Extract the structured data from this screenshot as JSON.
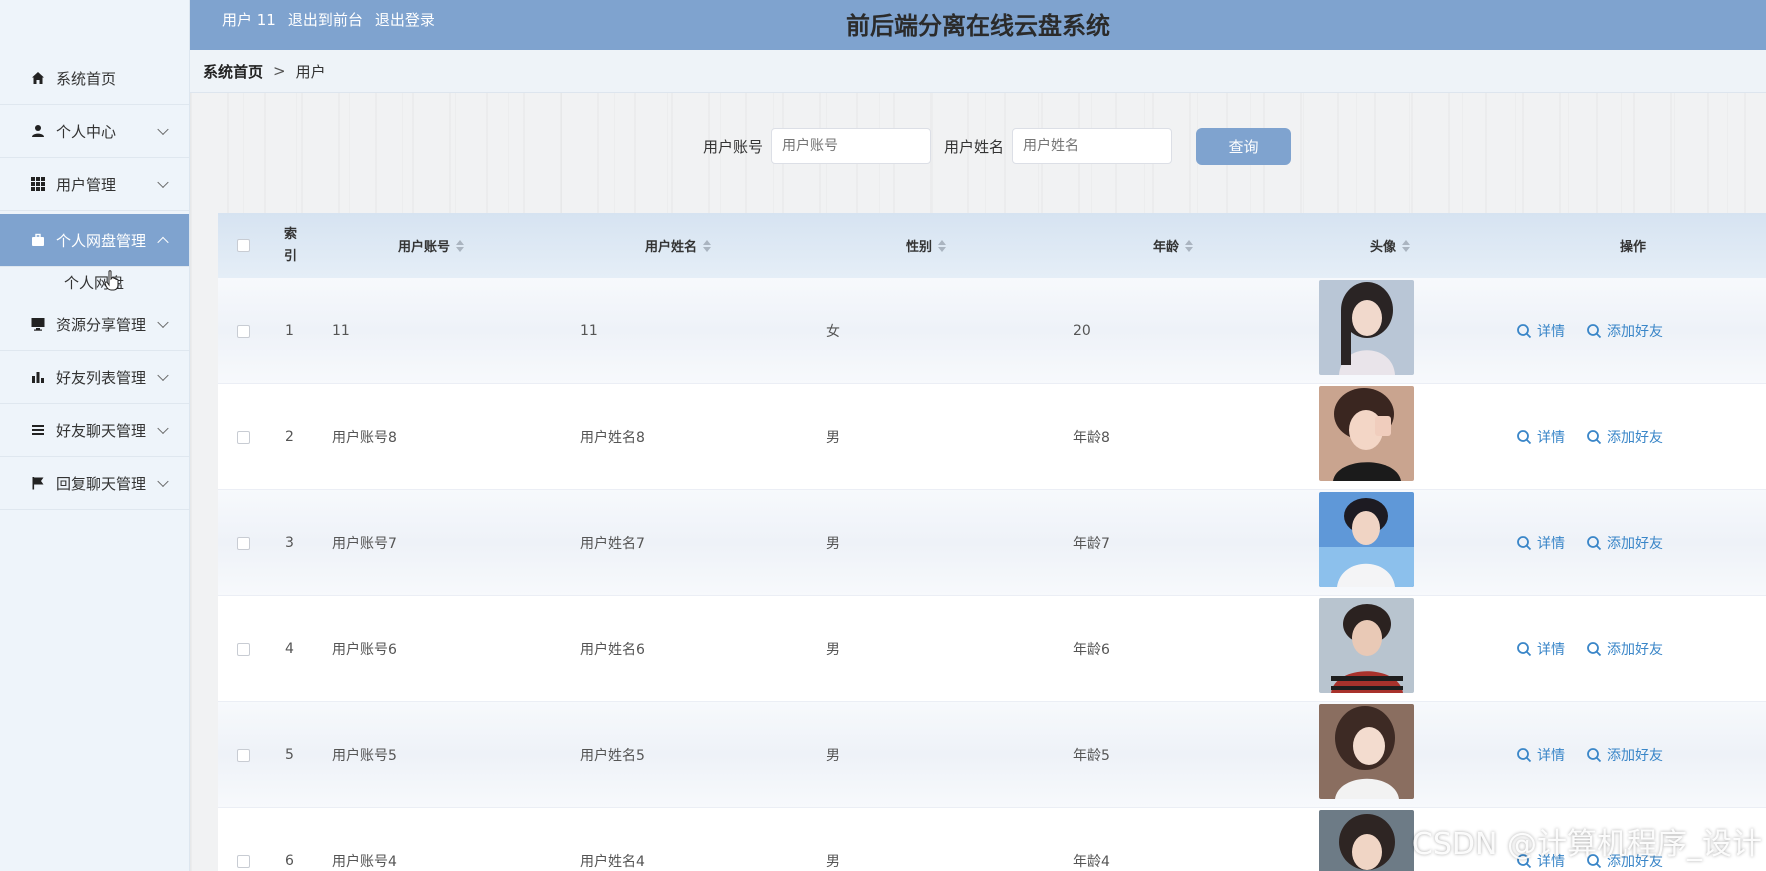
{
  "sidebar": {
    "items": [
      {
        "label": "系统首页",
        "icon": "home-icon"
      },
      {
        "label": "个人中心",
        "icon": "user-icon"
      },
      {
        "label": "用户管理",
        "icon": "grid-icon"
      },
      {
        "label": "个人网盘管理",
        "icon": "briefcase-icon"
      },
      {
        "label": "资源分享管理",
        "icon": "monitor-icon"
      },
      {
        "label": "好友列表管理",
        "icon": "bar-chart-icon"
      },
      {
        "label": "好友聊天管理",
        "icon": "list-icon"
      },
      {
        "label": "回复聊天管理",
        "icon": "flag-icon"
      }
    ],
    "submenu": "个人网盘"
  },
  "header": {
    "user": "用户 11",
    "to_front": "退出到前台",
    "logout": "退出登录",
    "title": "前后端分离在线云盘系统"
  },
  "breadcrumb": {
    "home": "系统首页",
    "sep": ">",
    "current": "用户"
  },
  "search": {
    "account_label": "用户账号",
    "account_placeholder": "用户账号",
    "name_label": "用户姓名",
    "name_placeholder": "用户姓名",
    "button": "查询"
  },
  "table": {
    "headers": {
      "index": "索引",
      "account": "用户账号",
      "name": "用户姓名",
      "gender": "性别",
      "age": "年龄",
      "avatar": "头像",
      "actions": "操作"
    },
    "rows": [
      {
        "index": "1",
        "account": "11",
        "name": "11",
        "gender": "女",
        "age": "20"
      },
      {
        "index": "2",
        "account": "用户账号8",
        "name": "用户姓名8",
        "gender": "男",
        "age": "年龄8"
      },
      {
        "index": "3",
        "account": "用户账号7",
        "name": "用户姓名7",
        "gender": "男",
        "age": "年龄7"
      },
      {
        "index": "4",
        "account": "用户账号6",
        "name": "用户姓名6",
        "gender": "男",
        "age": "年龄6"
      },
      {
        "index": "5",
        "account": "用户账号5",
        "name": "用户姓名5",
        "gender": "男",
        "age": "年龄5"
      },
      {
        "index": "6",
        "account": "用户账号4",
        "name": "用户姓名4",
        "gender": "男",
        "age": "年龄4"
      }
    ],
    "action_detail": "详情",
    "action_add_friend": "添加好友"
  },
  "colors": {
    "accent": "#7fa3cf",
    "link": "#3a86c8"
  },
  "watermark": "CSDN @计算机程序_设计"
}
